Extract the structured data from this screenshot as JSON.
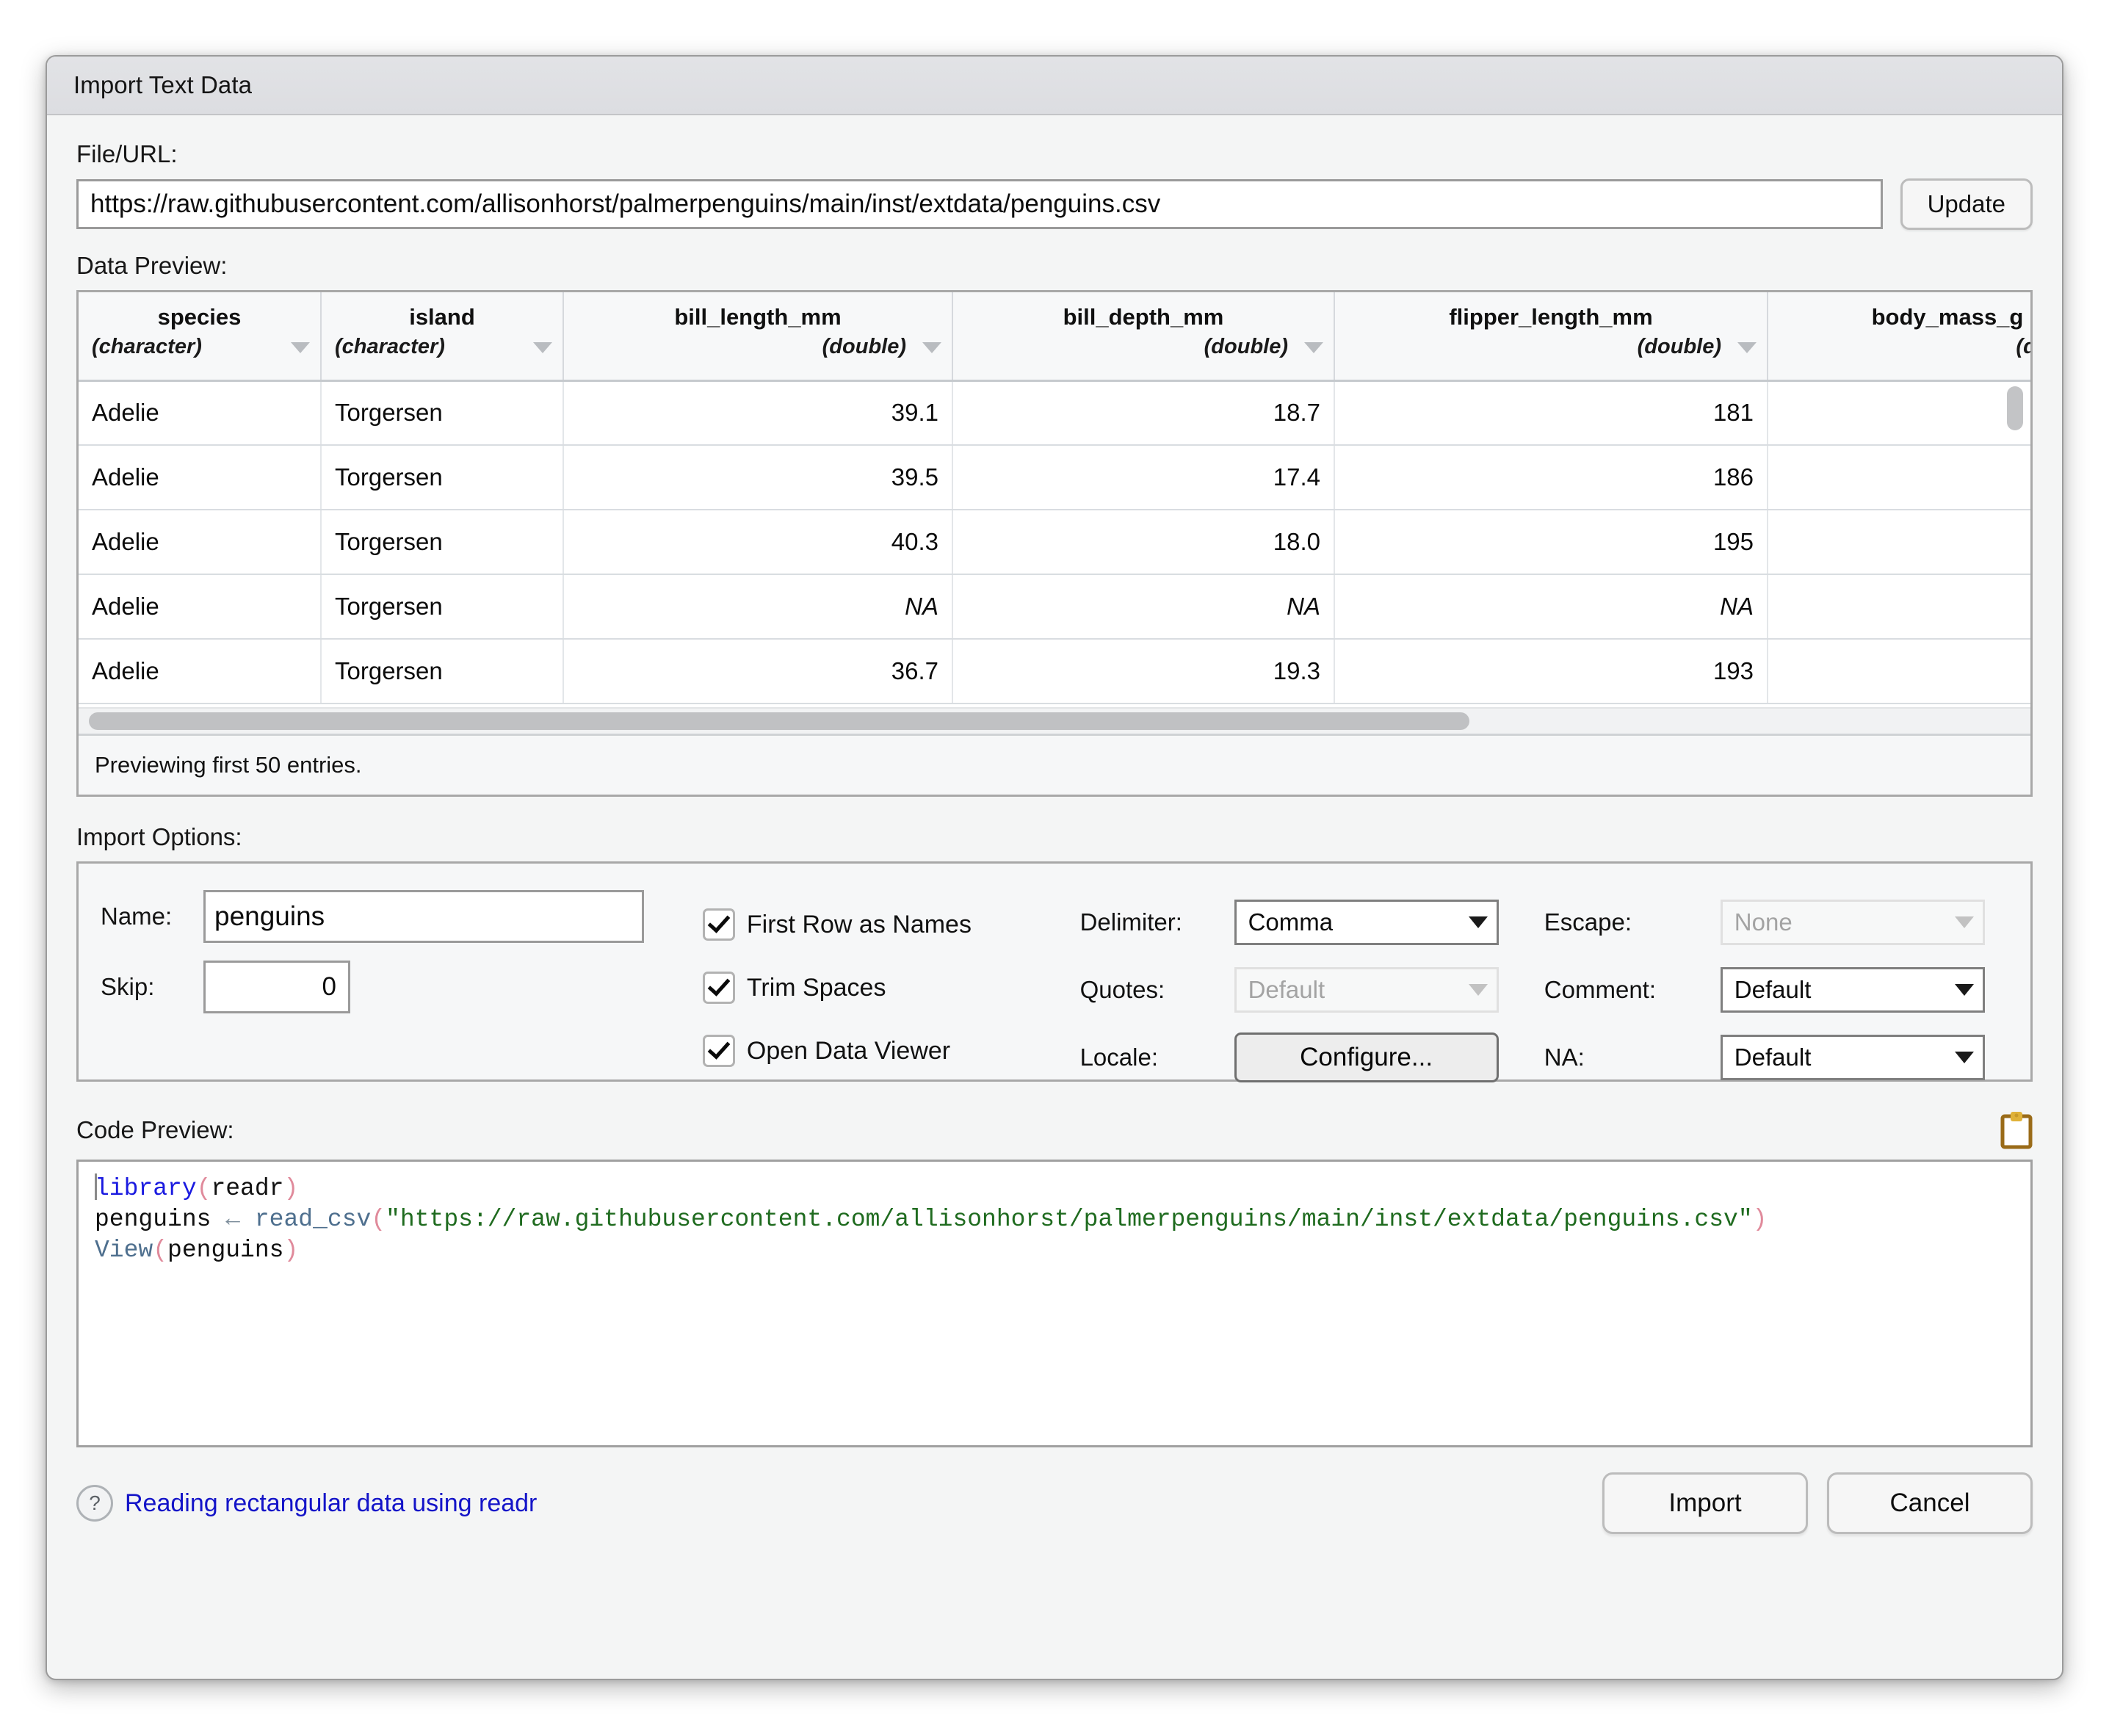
{
  "window": {
    "title": "Import Text Data"
  },
  "file_url": {
    "label": "File/URL:",
    "value": "https://raw.githubusercontent.com/allisonhorst/palmerpenguins/main/inst/extdata/penguins.csv",
    "update_label": "Update"
  },
  "data_preview": {
    "label": "Data Preview:",
    "status": "Previewing first 50 entries.",
    "columns": [
      {
        "name": "species",
        "type": "(character)",
        "align": "txt"
      },
      {
        "name": "island",
        "type": "(character)",
        "align": "txt"
      },
      {
        "name": "bill_length_mm",
        "type": "(double)",
        "align": "num"
      },
      {
        "name": "bill_depth_mm",
        "type": "(double)",
        "align": "num"
      },
      {
        "name": "flipper_length_mm",
        "type": "(double)",
        "align": "num"
      },
      {
        "name": "body_mass_g",
        "type": "(doubl",
        "align": "num"
      }
    ],
    "rows": [
      [
        "Adelie",
        "Torgersen",
        "39.1",
        "18.7",
        "181",
        ""
      ],
      [
        "Adelie",
        "Torgersen",
        "39.5",
        "17.4",
        "186",
        ""
      ],
      [
        "Adelie",
        "Torgersen",
        "40.3",
        "18.0",
        "195",
        ""
      ],
      [
        "Adelie",
        "Torgersen",
        "NA",
        "NA",
        "NA",
        ""
      ],
      [
        "Adelie",
        "Torgersen",
        "36.7",
        "19.3",
        "193",
        ""
      ]
    ]
  },
  "import_options": {
    "label": "Import Options:",
    "name_label": "Name:",
    "name_value": "penguins",
    "skip_label": "Skip:",
    "skip_value": "0",
    "checkboxes": [
      {
        "label": "First Row as Names",
        "checked": true
      },
      {
        "label": "Trim Spaces",
        "checked": true
      },
      {
        "label": "Open Data Viewer",
        "checked": true
      }
    ],
    "delimiter_label": "Delimiter:",
    "delimiter_value": "Comma",
    "quotes_label": "Quotes:",
    "quotes_value": "Default",
    "locale_label": "Locale:",
    "locale_button": "Configure...",
    "escape_label": "Escape:",
    "escape_value": "None",
    "comment_label": "Comment:",
    "comment_value": "Default",
    "na_label": "NA:",
    "na_value": "Default"
  },
  "code_preview": {
    "label": "Code Preview:",
    "line1_fn": "library",
    "line1_arg": "readr",
    "line2_var": "penguins",
    "line2_arrow": "←",
    "line2_fn": "read_csv",
    "line2_str": "\"https://raw.githubusercontent.com/allisonhorst/palmerpenguins/main/inst/extdata/penguins.csv\"",
    "line3_fn": "View",
    "line3_arg": "penguins",
    "copy_icon": "clipboard-icon"
  },
  "footer": {
    "help_mark": "?",
    "help_text": "Reading rectangular data using readr",
    "import_label": "Import",
    "cancel_label": "Cancel"
  },
  "colors": {
    "link": "#1414c8",
    "string": "#1f6b1f",
    "function": "#1a1ae0",
    "paren": "#e08a9b",
    "clipboard": "#9a6b18"
  }
}
